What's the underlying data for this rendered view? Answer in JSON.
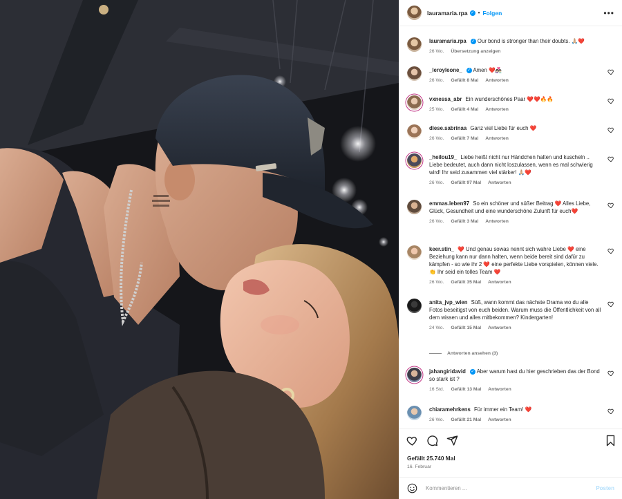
{
  "post": {
    "username": "lauramaria.rpa",
    "follow_label": "Folgen",
    "separator": "•",
    "more_label": "•••",
    "caption_text": "Our bond is stronger than their doubts. 🙏🏼❤️",
    "caption_age": "26 Wo.",
    "caption_translate": "Übersetzung anzeigen",
    "likes": "Gefällt 25.740 Mal",
    "date": "16. Februar"
  },
  "comments": [
    {
      "user": "_leroyleone_",
      "verified": true,
      "text": "Amen ❤️👩🏻‍❤️‍👨🏻",
      "age": "26 Wo.",
      "likes": "Gefällt 8 Mal",
      "reply": "Antworten"
    },
    {
      "user": "vxnessa_abr",
      "verified": false,
      "text": "Ein wunderschönes Paar ❤️❤️🔥🔥",
      "age": "25 Wo.",
      "likes": "Gefällt 4 Mal",
      "reply": "Antworten"
    },
    {
      "user": "diese.sabrinaa",
      "verified": false,
      "text": "Ganz viel Liebe für euch ❤️",
      "age": "26 Wo.",
      "likes": "Gefällt 7 Mal",
      "reply": "Antworten"
    },
    {
      "user": "_heilou19_",
      "verified": false,
      "text": "Liebe heißt nicht nur Händchen halten und kuscheln .. Liebe bedeutet, auch dann nicht loszulassen, wenn es mal schwierig wird! Ihr seid zusammen viel stärker! 🙏🏼❤️",
      "age": "26 Wo.",
      "likes": "Gefällt 97 Mal",
      "reply": "Antworten"
    },
    {
      "user": "emmas.leben97",
      "verified": false,
      "text": "So ein schöner und süßer Beitrag ❤️ Alles Liebe, Glück, Gesundheit und eine wunderschöne Zulunft für euch❤️",
      "age": "26 Wo.",
      "likes": "Gefällt 3 Mal",
      "reply": "Antworten"
    },
    {
      "user": "keer.stin_",
      "verified": false,
      "text": "❤️ Und genau sowas nennt sich wahre Liebe ❤️ eine Beziehung kann nur dann halten, wenn beide bereit sind dafür zu kämpfen - so wie ihr 2 ❤️ eine perfekte Liebe vorspielen, können viele. 👏 Ihr seid ein tolles Team ❤️",
      "age": "26 Wo.",
      "likes": "Gefällt 35 Mal",
      "reply": "Antworten"
    },
    {
      "user": "anita_jvp_wien",
      "verified": false,
      "text": "Süß, wann kommt das nächste Drama wo du alle Fotos beseitigst von euch beiden. Warum muss die Öffentlichkeit von all dem wissen und alles mitbekommen? Kindergarten!",
      "age": "24 Wo.",
      "likes": "Gefällt 15 Mal",
      "reply": "Antworten",
      "view_replies": "Antworten ansehen (3)"
    },
    {
      "user": "jahangiridavid",
      "verified": true,
      "text": "Aber warum hast du hier geschrieben das der Bond so stark ist ?",
      "age": "16 Std.",
      "likes": "Gefällt 13 Mal",
      "reply": "Antworten"
    },
    {
      "user": "chiaramehrkens",
      "verified": false,
      "text": "Für immer ein Team! ❤️",
      "age": "26 Wo.",
      "likes": "Gefällt 21 Mal",
      "reply": "Antworten"
    }
  ],
  "add_comment": {
    "placeholder": "Kommentieren ...",
    "post_label": "Posten"
  },
  "colors": {
    "accent": "#0095f6",
    "heart": "#e0245e",
    "muted": "#737373"
  },
  "icons": [
    "more-icon",
    "heart-icon",
    "comment-icon",
    "share-icon",
    "bookmark-icon",
    "emoji-icon",
    "verified-icon"
  ]
}
